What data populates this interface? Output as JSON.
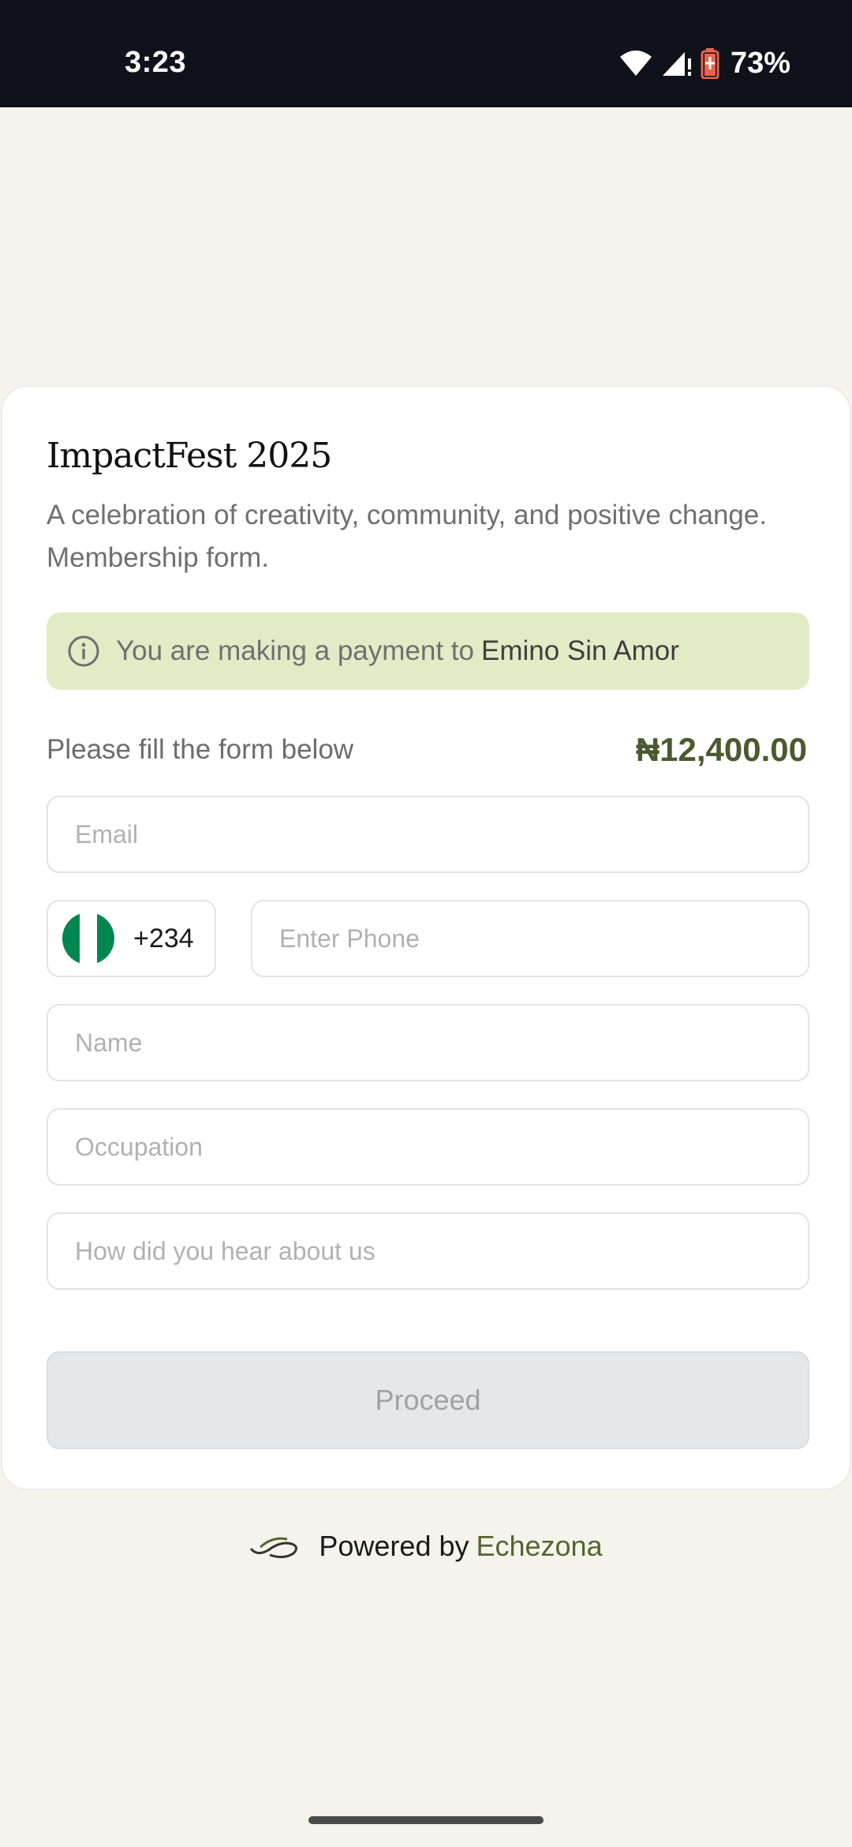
{
  "status_bar": {
    "time": "3:23",
    "battery_percent": "73%",
    "icons": [
      "wifi-icon",
      "signal-icon",
      "battery-icon"
    ],
    "battery_color": "#e8644a"
  },
  "form": {
    "title": "ImpactFest 2025",
    "subtitle": "A celebration of creativity, community, and positive change. Membership form.",
    "notice": {
      "icon": "info-icon",
      "text": "You are making a payment to",
      "payee": "Emino Sin Amor"
    },
    "fill_label": "Please fill the form below",
    "amount": "₦12,400.00",
    "fields": {
      "email_placeholder": "Email",
      "country_code": "+234",
      "country_flag": "nigeria-flag-icon",
      "phone_placeholder": "Enter Phone",
      "name_placeholder": "Name",
      "occupation_placeholder": "Occupation",
      "hear_placeholder": "How did you hear about us"
    },
    "proceed_label": "Proceed"
  },
  "footer": {
    "powered_by": "Powered by",
    "brand": "Echezona"
  },
  "colors": {
    "accent": "#4b5a2e",
    "notice_bg": "#e1ebc6",
    "page_bg": "#f4f4ed"
  }
}
